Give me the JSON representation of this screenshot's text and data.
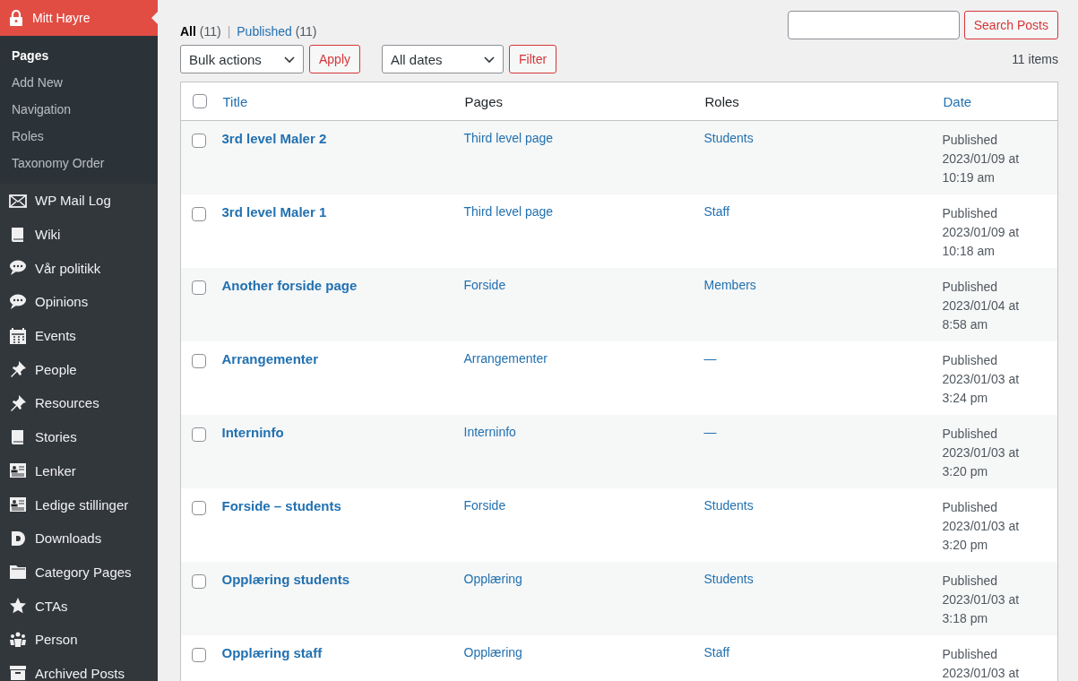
{
  "sidebar": {
    "current": {
      "label": "Mitt Høyre"
    },
    "submenu": [
      {
        "label": "Pages",
        "selected": true
      },
      {
        "label": "Add New",
        "selected": false
      },
      {
        "label": "Navigation",
        "selected": false
      },
      {
        "label": "Roles",
        "selected": false
      },
      {
        "label": "Taxonomy Order",
        "selected": false
      }
    ],
    "items": [
      {
        "label": "WP Mail Log"
      },
      {
        "label": "Wiki"
      },
      {
        "label": "Vår politikk"
      },
      {
        "label": "Opinions"
      },
      {
        "label": "Events"
      },
      {
        "label": "People"
      },
      {
        "label": "Resources"
      },
      {
        "label": "Stories"
      },
      {
        "label": "Lenker"
      },
      {
        "label": "Ledige stillinger"
      },
      {
        "label": "Downloads"
      },
      {
        "label": "Category Pages"
      },
      {
        "label": "CTAs"
      },
      {
        "label": "Person"
      },
      {
        "label": "Archived Posts"
      }
    ]
  },
  "views": [
    {
      "label": "All",
      "count": "(11)",
      "selected": true
    },
    {
      "label": "Published",
      "count": "(11)",
      "selected": false
    }
  ],
  "views_separator": "|",
  "search": {
    "button": "Search Posts"
  },
  "bulk_actions": {
    "value": "Bulk actions",
    "button": "Apply"
  },
  "date_filter": {
    "value": "All dates",
    "button": "Filter"
  },
  "item_count": "11 items",
  "table": {
    "select_all_checked": false,
    "columns": [
      {
        "label": "Title",
        "sortable": true
      },
      {
        "label": "Pages",
        "sortable": false
      },
      {
        "label": "Roles",
        "sortable": false
      },
      {
        "label": "Date",
        "sortable": true
      }
    ],
    "rows": [
      {
        "title": "3rd level Maler 2",
        "pages": "Third level page",
        "roles": "Students",
        "date": "Published 2023/01/09 at 10:19 am",
        "checked": false
      },
      {
        "title": "3rd level Maler 1",
        "pages": "Third level page",
        "roles": "Staff",
        "date": "Published 2023/01/09 at 10:18 am",
        "checked": false
      },
      {
        "title": "Another forside page",
        "pages": "Forside",
        "roles": "Members",
        "date": "Published 2023/01/04 at 8:58 am",
        "checked": false
      },
      {
        "title": "Arrangementer",
        "pages": "Arrangementer",
        "roles": "—",
        "date": "Published 2023/01/03 at 3:24 pm",
        "checked": false
      },
      {
        "title": "Interninfo",
        "pages": "Interninfo",
        "roles": "—",
        "date": "Published 2023/01/03 at 3:20 pm",
        "checked": false
      },
      {
        "title": "Forside – students",
        "pages": "Forside",
        "roles": "Students",
        "date": "Published 2023/01/03 at 3:20 pm",
        "checked": false
      },
      {
        "title": "Opplæring students",
        "pages": "Opplæring",
        "roles": "Students",
        "date": "Published 2023/01/03 at 3:18 pm",
        "checked": false
      },
      {
        "title": "Opplæring staff",
        "pages": "Opplæring",
        "roles": "Staff",
        "date": "Published 2023/01/03 at",
        "checked": false
      }
    ]
  }
}
